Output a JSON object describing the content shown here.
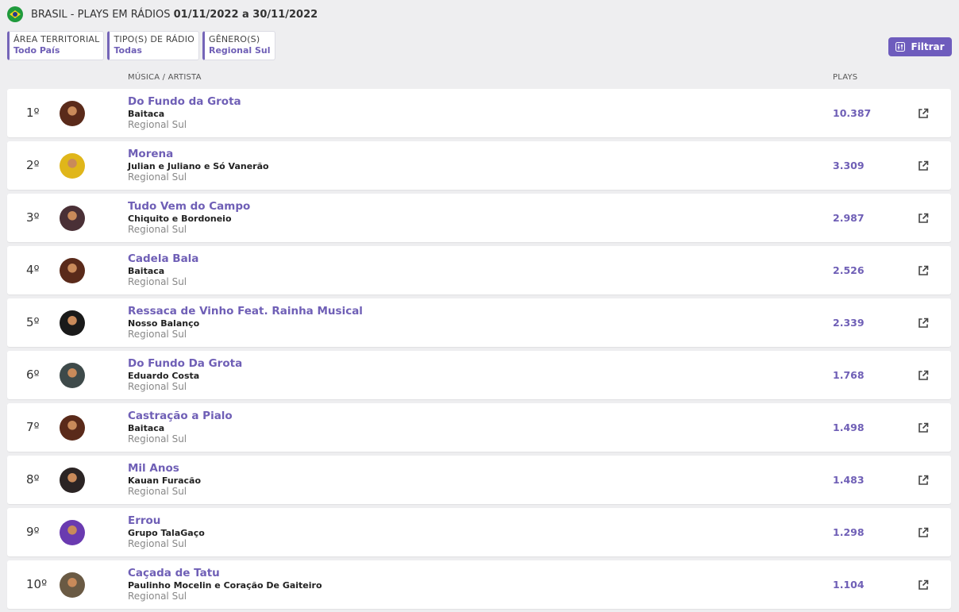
{
  "header": {
    "title_prefix": "BRASIL - PLAYS EM RÁDIOS",
    "date_range": "01/11/2022 a 30/11/2022",
    "flag_icon": "brazil-flag-icon"
  },
  "filters": [
    {
      "label": "ÁREA TERRITORIAL",
      "value": "Todo País"
    },
    {
      "label": "TIPO(S) DE RÁDIO",
      "value": "Todas"
    },
    {
      "label": "GÊNERO(S)",
      "value": "Regional Sul"
    }
  ],
  "filter_button": {
    "label": "Filtrar",
    "icon": "sliders-icon"
  },
  "columns": {
    "music_artist": "MÚSICA / ARTISTA",
    "plays": "PLAYS"
  },
  "colors": {
    "accent": "#6f5fb6",
    "button": "#6e5cbd",
    "background": "#eeeef0"
  },
  "rows": [
    {
      "rank": "1º",
      "song": "Do Fundo da Grota",
      "artist": "Baitaca",
      "genre": "Regional Sul",
      "plays": "10.387",
      "avatar": "#5a2a1a"
    },
    {
      "rank": "2º",
      "song": "Morena",
      "artist": "Julian e Juliano e Só Vanerão",
      "genre": "Regional Sul",
      "plays": "3.309",
      "avatar": "#e0b61a"
    },
    {
      "rank": "3º",
      "song": "Tudo Vem do Campo",
      "artist": "Chiquito e Bordoneio",
      "genre": "Regional Sul",
      "plays": "2.987",
      "avatar": "#4a3036"
    },
    {
      "rank": "4º",
      "song": "Cadela Bala",
      "artist": "Baitaca",
      "genre": "Regional Sul",
      "plays": "2.526",
      "avatar": "#5a2a1a"
    },
    {
      "rank": "5º",
      "song": "Ressaca de Vinho Feat. Rainha Musical",
      "artist": "Nosso Balanço",
      "genre": "Regional Sul",
      "plays": "2.339",
      "avatar": "#1a1a1a"
    },
    {
      "rank": "6º",
      "song": "Do Fundo Da Grota",
      "artist": "Eduardo Costa",
      "genre": "Regional Sul",
      "plays": "1.768",
      "avatar": "#3e4a4a"
    },
    {
      "rank": "7º",
      "song": "Castração a Pialo",
      "artist": "Baitaca",
      "genre": "Regional Sul",
      "plays": "1.498",
      "avatar": "#5a2a1a"
    },
    {
      "rank": "8º",
      "song": "Mil Anos",
      "artist": "Kauan Furacão",
      "genre": "Regional Sul",
      "plays": "1.483",
      "avatar": "#2b2424"
    },
    {
      "rank": "9º",
      "song": "Errou",
      "artist": "Grupo TalaGaço",
      "genre": "Regional Sul",
      "plays": "1.298",
      "avatar": "#6a3ab0"
    },
    {
      "rank": "10º",
      "song": "Caçada de Tatu",
      "artist": "Paulinho Mocelin e Coração De Gaiteiro",
      "genre": "Regional Sul",
      "plays": "1.104",
      "avatar": "#6a5a44"
    }
  ],
  "row_action_icon": "external-link-icon"
}
